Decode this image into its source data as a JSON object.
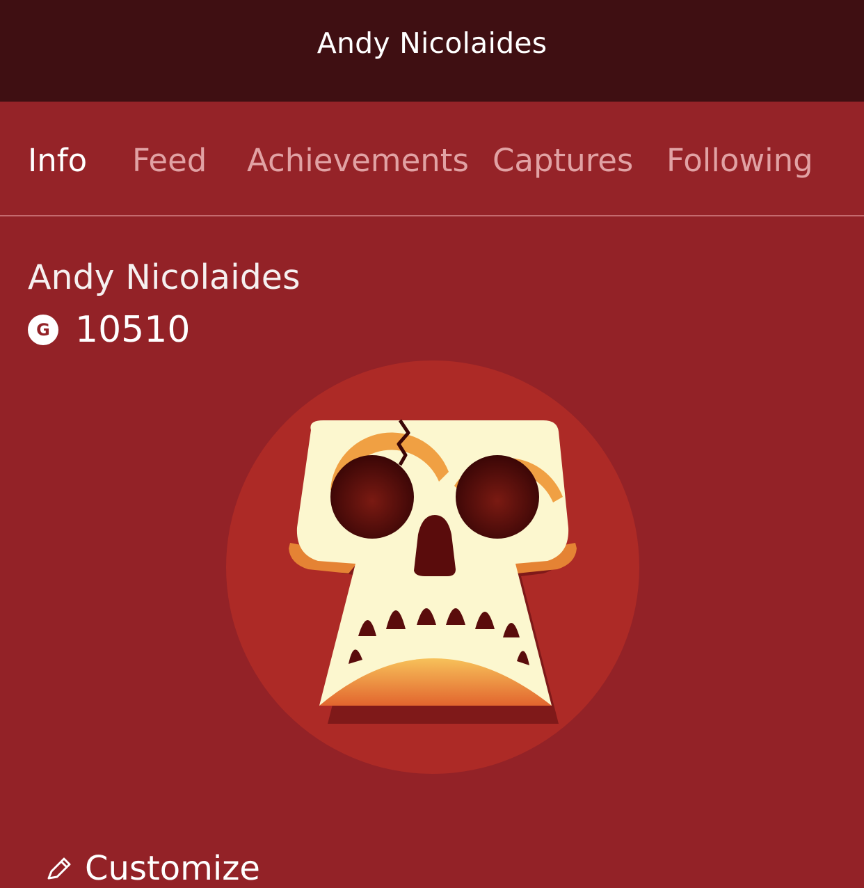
{
  "header": {
    "title": "Andy Nicolaides"
  },
  "tabs": [
    {
      "label": "Info",
      "active": true
    },
    {
      "label": "Feed",
      "active": false
    },
    {
      "label": "Achievements",
      "active": false
    },
    {
      "label": "Captures",
      "active": false
    },
    {
      "label": "Following",
      "active": false
    }
  ],
  "profile": {
    "name": "Andy Nicolaides",
    "gamerscore_icon": "G",
    "gamerscore": "10510",
    "avatar_icon": "skull-icon"
  },
  "actions": {
    "customize_label": "Customize"
  },
  "colors": {
    "header_bg": "#3f0f12",
    "accent_bg": "#932227",
    "tab_inactive": "#e1a2a4",
    "avatar_circle": "#ad2a26"
  }
}
